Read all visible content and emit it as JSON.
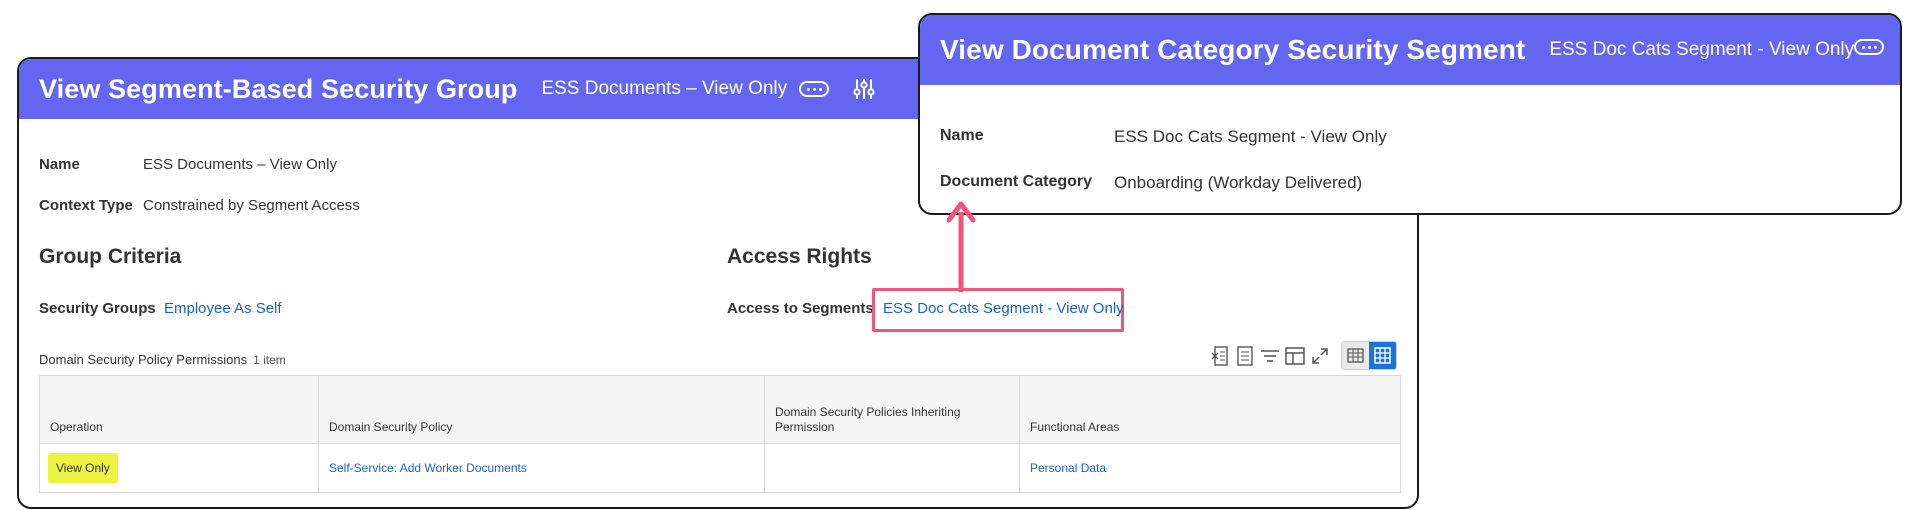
{
  "main": {
    "title": "View Segment-Based Security Group",
    "subtitle": "ESS Documents – View Only",
    "fields": [
      {
        "label": "Name",
        "value": "ESS Documents – View Only"
      },
      {
        "label": "Context Type",
        "value": "Constrained by Segment Access"
      }
    ],
    "group_criteria": {
      "title": "Group Criteria",
      "label": "Security Groups",
      "value": "Employee As Self"
    },
    "access_rights": {
      "title": "Access Rights",
      "label": "Access to Segments",
      "value": "ESS Doc Cats Segment - View Only"
    },
    "grid": {
      "caption": "Domain Security Policy Permissions",
      "count": "1 item",
      "columns": [
        "Operation",
        "Domain Security Policy",
        "Domain Security Policies Inheriting Permission",
        "Functional Areas"
      ],
      "rows": [
        {
          "operation": "View Only",
          "policy": "Self-Service: Add Worker Documents",
          "inheriting": "",
          "areas": "Personal Data"
        }
      ]
    }
  },
  "popup": {
    "title": "View Document Category Security Segment",
    "subtitle": "ESS Doc Cats Segment - View Only",
    "fields": [
      {
        "label": "Name",
        "value": "ESS Doc Cats Segment - View Only"
      },
      {
        "label": "Document Category",
        "value": "Onboarding (Workday Delivered)"
      }
    ]
  },
  "colors": {
    "header": "#6366f1",
    "link": "#1a63c9",
    "highlight": "#f1567a",
    "operation_tag": "#eef240",
    "active_toggle": "#1a73d9"
  },
  "icons": [
    "more-icon",
    "settings-sliders-icon",
    "export-excel-icon",
    "export-pdf-icon",
    "filter-icon",
    "columns-icon",
    "fullscreen-icon",
    "table-view-icon",
    "grid-view-icon",
    "arrow-up-icon"
  ]
}
